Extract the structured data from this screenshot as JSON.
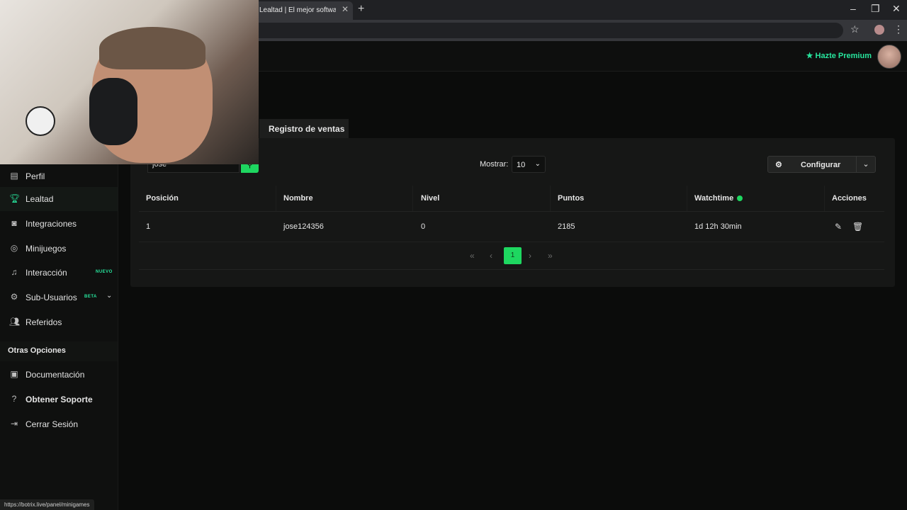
{
  "browser": {
    "tab_title": "Lealtad | El mejor software para",
    "tab_close": "✕",
    "new_tab": "+",
    "status_url": "https://botrix.live/panel/minigames"
  },
  "header": {
    "premium_label": "Hazte Premium",
    "premium_icon": "star-icon"
  },
  "sidebar": {
    "items": [
      {
        "label": "Perfil",
        "icon": "id-card-icon"
      },
      {
        "label": "Lealtad",
        "icon": "trophy-icon",
        "active": true
      },
      {
        "label": "Integraciones",
        "icon": "discord-icon"
      },
      {
        "label": "Minijuegos",
        "icon": "gamepad-icon"
      },
      {
        "label": "Interacción",
        "icon": "music-icon",
        "badge": "NUEVO"
      },
      {
        "label": "Sub-Usuarios",
        "icon": "users-cog-icon",
        "badge": "BETA"
      },
      {
        "label": "Referidos",
        "icon": "user-friends-icon"
      }
    ],
    "section_title": "Otras Opciones",
    "other_items": [
      {
        "label": "Documentación",
        "icon": "book-icon"
      },
      {
        "label": "Obtener Soporte",
        "icon": "question-circle-icon"
      },
      {
        "label": "Cerrar Sesión",
        "icon": "sign-out-icon"
      }
    ]
  },
  "main": {
    "active_tab": "Registro de ventas",
    "search_value": "jose",
    "show_label": "Mostrar:",
    "show_value": "10",
    "config_label": "Configurar",
    "table": {
      "columns": [
        "Posición",
        "Nombre",
        "Nivel",
        "Puntos",
        "Watchtime",
        "Acciones"
      ],
      "rows": [
        {
          "position": "1",
          "name": "jose124356",
          "level": "0",
          "points": "2185",
          "watchtime": "1d 12h 30min"
        }
      ]
    },
    "pagination": {
      "first": "«",
      "prev": "‹",
      "current": "1",
      "next": "›",
      "last": "»"
    }
  },
  "colors": {
    "accent": "#1ed760",
    "premium": "#27e59d",
    "background": "#0b0c0b",
    "panel": "#161716"
  }
}
